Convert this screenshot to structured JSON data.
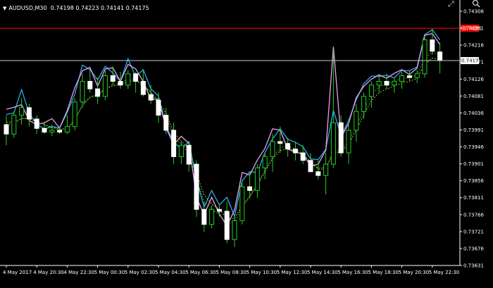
{
  "header": {
    "symbol_label": "AUDUSD,M30",
    "ohlc": "0.74198 0.74223 0.74141 0.74175"
  },
  "icons": {
    "menu": "dropdown-triangle-icon",
    "expand": "expand-arrows-icon",
    "zoom": "magnifier-icon"
  },
  "chart_data": {
    "type": "candlestick",
    "symbol": "AUDUSD",
    "timeframe": "M30",
    "ohlc_current": {
      "open": 0.74198,
      "high": 0.74223,
      "low": 0.74141,
      "close": 0.74175
    },
    "y_ticks": [
      "0.74306",
      "0.74261",
      "0.74216",
      "0.74171",
      "0.74126",
      "0.74081",
      "0.74036",
      "0.73991",
      "0.73946",
      "0.73901",
      "0.73856",
      "0.73811",
      "0.73766",
      "0.73721",
      "0.73676",
      "0.73631"
    ],
    "ylim": [
      0.73631,
      0.74306
    ],
    "x_ticks": [
      {
        "i": 0,
        "label": "4 May 2017"
      },
      {
        "i": 4,
        "label": "4 May 20:30"
      },
      {
        "i": 8,
        "label": "4 May 22:30"
      },
      {
        "i": 12,
        "label": "5 May 00:30"
      },
      {
        "i": 16,
        "label": "5 May 02:30"
      },
      {
        "i": 20,
        "label": "5 May 04:30"
      },
      {
        "i": 24,
        "label": "5 May 06:30"
      },
      {
        "i": 28,
        "label": "5 May 08:30"
      },
      {
        "i": 32,
        "label": "5 May 10:30"
      },
      {
        "i": 36,
        "label": "5 May 12:30"
      },
      {
        "i": 40,
        "label": "5 May 14:30"
      },
      {
        "i": 44,
        "label": "5 May 16:30"
      },
      {
        "i": 48,
        "label": "5 May 18:30"
      },
      {
        "i": 52,
        "label": "5 May 20:30"
      },
      {
        "i": 56,
        "label": "5 May 22:30"
      }
    ],
    "price_lines": [
      {
        "label": "0.74261",
        "value": 0.74261,
        "color": "#ff0000",
        "tag_bg": "#ff0000",
        "tag_fg": "#ffffff"
      },
      {
        "label": "0.74175",
        "value": 0.74175,
        "color": "#c8c8c8",
        "tag_bg": "#ffffff",
        "tag_fg": "#000000"
      }
    ],
    "candles": [
      [
        0.74005,
        0.7403,
        0.7395,
        0.7398
      ],
      [
        0.7398,
        0.7404,
        0.7397,
        0.7403
      ],
      [
        0.7403,
        0.74075,
        0.74005,
        0.7405
      ],
      [
        0.7405,
        0.7406,
        0.74,
        0.7402
      ],
      [
        0.7402,
        0.7403,
        0.7398,
        0.73995
      ],
      [
        0.73995,
        0.7401,
        0.7398,
        0.73985
      ],
      [
        0.73985,
        0.74005,
        0.73975,
        0.7399
      ],
      [
        0.7399,
        0.74,
        0.7398,
        0.73985
      ],
      [
        0.73985,
        0.7403,
        0.7398,
        0.74
      ],
      [
        0.74,
        0.74075,
        0.7399,
        0.74065
      ],
      [
        0.74065,
        0.7414,
        0.7405,
        0.7412
      ],
      [
        0.7412,
        0.7415,
        0.7409,
        0.741
      ],
      [
        0.741,
        0.7413,
        0.7406,
        0.7408
      ],
      [
        0.7408,
        0.7415,
        0.7407,
        0.74135
      ],
      [
        0.74135,
        0.7416,
        0.7411,
        0.7412
      ],
      [
        0.7412,
        0.74145,
        0.741,
        0.7411
      ],
      [
        0.7411,
        0.7415,
        0.741,
        0.7414
      ],
      [
        0.7414,
        0.74145,
        0.7409,
        0.7412
      ],
      [
        0.7412,
        0.7415,
        0.7408,
        0.74085
      ],
      [
        0.74085,
        0.7411,
        0.7406,
        0.7407
      ],
      [
        0.7407,
        0.7409,
        0.7401,
        0.7403
      ],
      [
        0.7403,
        0.7405,
        0.7398,
        0.7399
      ],
      [
        0.7399,
        0.7401,
        0.739,
        0.7392
      ],
      [
        0.7392,
        0.7396,
        0.739,
        0.7395
      ],
      [
        0.7395,
        0.7396,
        0.7388,
        0.739
      ],
      [
        0.739,
        0.7391,
        0.7376,
        0.7378
      ],
      [
        0.7378,
        0.738,
        0.7372,
        0.7374
      ],
      [
        0.7374,
        0.7379,
        0.7373,
        0.7378
      ],
      [
        0.7378,
        0.7379,
        0.7376,
        0.73775
      ],
      [
        0.73775,
        0.738,
        0.7369,
        0.737
      ],
      [
        0.737,
        0.7376,
        0.7368,
        0.7375
      ],
      [
        0.7375,
        0.7385,
        0.7374,
        0.7384
      ],
      [
        0.7384,
        0.7388,
        0.7381,
        0.7383
      ],
      [
        0.7383,
        0.739,
        0.7381,
        0.7389
      ],
      [
        0.7389,
        0.7393,
        0.7386,
        0.7392
      ],
      [
        0.7392,
        0.7398,
        0.7388,
        0.7396
      ],
      [
        0.7396,
        0.74,
        0.7393,
        0.73955
      ],
      [
        0.73955,
        0.7397,
        0.7392,
        0.7394
      ],
      [
        0.7394,
        0.7396,
        0.7391,
        0.7393
      ],
      [
        0.7393,
        0.7395,
        0.739,
        0.7391
      ],
      [
        0.7391,
        0.7393,
        0.7388,
        0.7388
      ],
      [
        0.7388,
        0.7391,
        0.7386,
        0.7387
      ],
      [
        0.7387,
        0.7393,
        0.7382,
        0.739
      ],
      [
        0.739,
        0.742,
        0.7389,
        0.7401
      ],
      [
        0.7401,
        0.7403,
        0.7392,
        0.7393
      ],
      [
        0.7393,
        0.7402,
        0.739,
        0.7399
      ],
      [
        0.7399,
        0.7406,
        0.7396,
        0.7404
      ],
      [
        0.7404,
        0.7409,
        0.7402,
        0.7408
      ],
      [
        0.7408,
        0.7412,
        0.7405,
        0.7411
      ],
      [
        0.7411,
        0.7414,
        0.7409,
        0.7412
      ],
      [
        0.7412,
        0.7414,
        0.741,
        0.7411
      ],
      [
        0.7411,
        0.7413,
        0.7409,
        0.7412
      ],
      [
        0.7412,
        0.74145,
        0.741,
        0.74135
      ],
      [
        0.74135,
        0.7415,
        0.7412,
        0.7413
      ],
      [
        0.7413,
        0.7415,
        0.74115,
        0.7414
      ],
      [
        0.7414,
        0.7424,
        0.7413,
        0.7423
      ],
      [
        0.7423,
        0.7426,
        0.7419,
        0.742
      ],
      [
        0.74198,
        0.74223,
        0.74141,
        0.74175
      ]
    ],
    "indicators": [
      {
        "color": "#2fa8e6",
        "style": "solid",
        "values": [
          0.74032,
          0.74036,
          0.74098,
          0.74035,
          0.74006,
          0.73993,
          0.74,
          0.73996,
          0.74037,
          0.74086,
          0.74163,
          0.74151,
          0.74124,
          0.7416,
          0.74142,
          0.7412,
          0.7418,
          0.74132,
          0.74151,
          0.741,
          0.74081,
          0.74,
          0.7396,
          0.73939,
          0.7396,
          0.7386,
          0.73786,
          0.7383,
          0.73792,
          0.73812,
          0.73762,
          0.73856,
          0.7388,
          0.73878,
          0.73931,
          0.73967,
          0.73994,
          0.73966,
          0.73958,
          0.73946,
          0.73914,
          0.73912,
          0.7394,
          0.74043,
          0.73976,
          0.74015,
          0.74071,
          0.74114,
          0.74134,
          0.74133,
          0.74136,
          0.74129,
          0.74149,
          0.74148,
          0.74158,
          0.74244,
          0.74257,
          0.7423
        ]
      },
      {
        "color": "#e8a0f0",
        "style": "solid",
        "values": [
          0.74046,
          0.74051,
          0.74058,
          0.74016,
          0.74005,
          0.7401,
          0.74021,
          0.73996,
          0.74042,
          0.74103,
          0.74148,
          0.74157,
          0.74107,
          0.74153,
          0.74156,
          0.7412,
          0.74165,
          0.74153,
          0.7412,
          0.74072,
          0.74073,
          0.73996,
          0.73952,
          0.73974,
          0.73955,
          0.73812,
          0.73766,
          0.73812,
          0.73768,
          0.73736,
          0.73778,
          0.73878,
          0.73871,
          0.73911,
          0.73942,
          0.73994,
          0.7399,
          0.7394,
          0.73932,
          0.73927,
          0.73895,
          0.739,
          0.73937,
          0.74212,
          0.73971,
          0.74008,
          0.74077,
          0.74107,
          0.74126,
          0.74137,
          0.74128,
          0.74141,
          0.74151,
          0.74138,
          0.74155,
          0.74242,
          0.74247,
          0.74218
        ]
      },
      {
        "color": "#3bbf3b",
        "style": "dashed",
        "values": [
          0.74005,
          0.74008,
          0.74023,
          0.74019,
          0.74013,
          0.74003,
          0.73996,
          0.73991,
          0.73993,
          0.74016,
          0.74058,
          0.7408,
          0.74085,
          0.74102,
          0.74112,
          0.74115,
          0.74126,
          0.74126,
          0.7411,
          0.74091,
          0.7406,
          0.74027,
          0.73973,
          0.73953,
          0.73928,
          0.73862,
          0.73801,
          0.7378,
          0.73766,
          0.73742,
          0.73745,
          0.73784,
          0.73813,
          0.73846,
          0.73885,
          0.7392,
          0.73944,
          0.73948,
          0.73941,
          0.73928,
          0.73905,
          0.73886,
          0.73887,
          0.73935,
          0.73936,
          0.7396,
          0.74001,
          0.74046,
          0.74085,
          0.74105,
          0.74114,
          0.74119,
          0.74127,
          0.7413,
          0.74137,
          0.7418,
          0.74198,
          0.7419
        ]
      },
      {
        "color": "#e8e040",
        "style": "dashed",
        "values": [
          0.74012,
          0.7401,
          0.74021,
          0.74021,
          0.74014,
          0.74006,
          0.73998,
          0.73993,
          0.73995,
          0.74018,
          0.74055,
          0.74077,
          0.74082,
          0.74098,
          0.74108,
          0.74111,
          0.7412,
          0.74122,
          0.74108,
          0.74092,
          0.74066,
          0.74035,
          0.73985,
          0.73962,
          0.73938,
          0.73875,
          0.73818,
          0.73794,
          0.7378,
          0.73756,
          0.73756,
          0.7379,
          0.73815,
          0.73845,
          0.7388,
          0.73914,
          0.73936,
          0.73941,
          0.73936,
          0.73925,
          0.73905,
          0.73889,
          0.7389,
          0.7393,
          0.73932,
          0.73953,
          0.7399,
          0.74032,
          0.74069,
          0.7409,
          0.741,
          0.74107,
          0.74116,
          0.7412,
          0.74128,
          0.74165,
          0.74182,
          0.74178
        ]
      }
    ]
  }
}
